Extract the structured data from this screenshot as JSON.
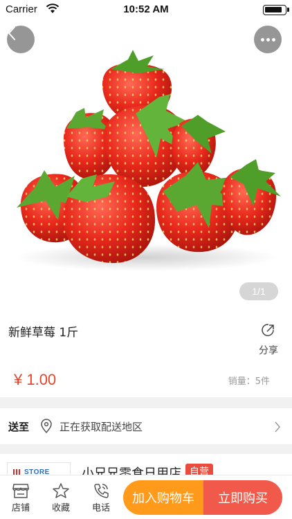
{
  "status_bar": {
    "carrier": "Carrier",
    "time": "10:52 AM"
  },
  "product": {
    "image_subject": "strawberries",
    "pager": "1/1",
    "title": "新鲜草莓 1斤",
    "share_label": "分享",
    "price": "¥ 1.00",
    "sales": "销量：5件"
  },
  "delivery": {
    "label": "送至",
    "text": "正在获取配送地区"
  },
  "store": {
    "logo_text": "STORE LOGO",
    "name": "小兄兄零食日用店",
    "tag": "自营"
  },
  "bottom_bar": {
    "tabs": [
      {
        "label": "店铺",
        "icon": "store-icon"
      },
      {
        "label": "收藏",
        "icon": "star-icon"
      },
      {
        "label": "电话",
        "icon": "phone-icon"
      }
    ],
    "add_to_cart": "加入购物车",
    "buy_now": "立即购买"
  },
  "colors": {
    "price": "#e5442b",
    "cart_button": "#ff9a1a",
    "buy_button": "#f15a4a",
    "self_run_tag": "#e94c3d"
  }
}
